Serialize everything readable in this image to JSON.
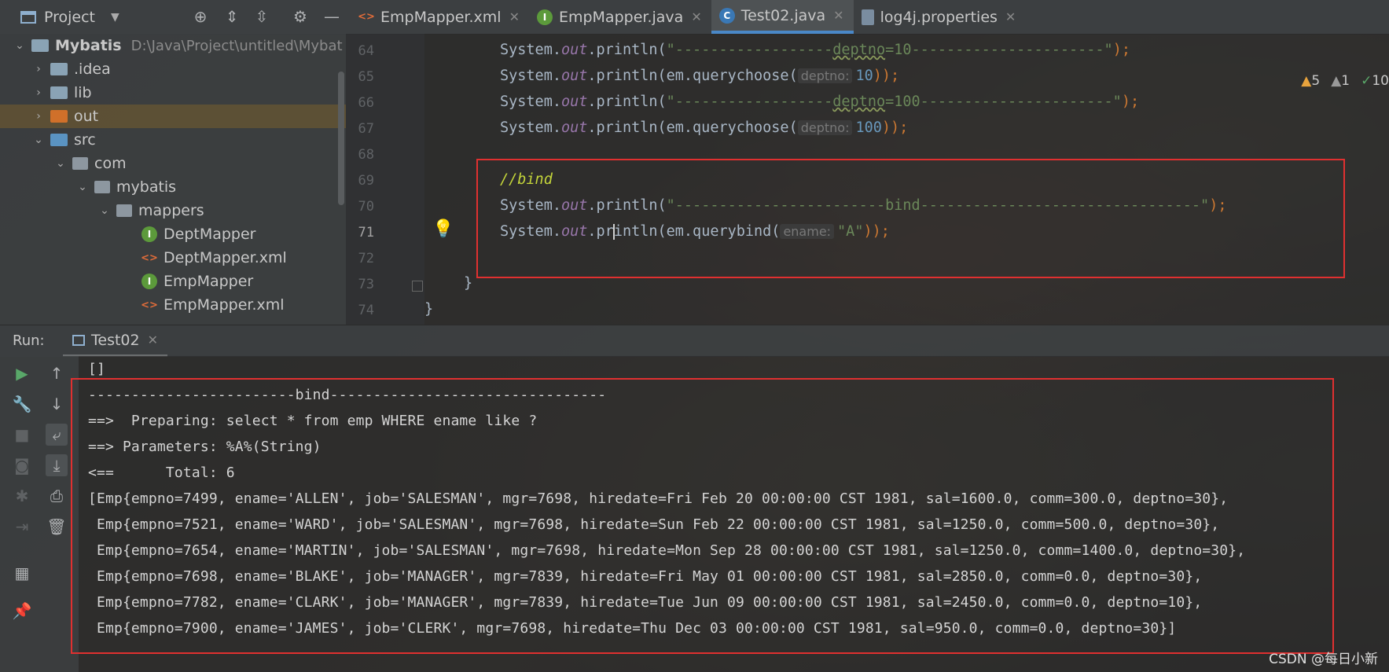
{
  "project_panel": {
    "title": "Project",
    "tree": [
      {
        "label": "Mybatis",
        "path": "D:\\Java\\Project\\untitled\\Mybat",
        "type": "module",
        "expanded": true
      },
      {
        "label": ".idea",
        "type": "folder",
        "expanded": false
      },
      {
        "label": "lib",
        "type": "folder",
        "expanded": false
      },
      {
        "label": "out",
        "type": "folder-excluded",
        "expanded": false,
        "selected": true
      },
      {
        "label": "src",
        "type": "folder-source",
        "expanded": true
      },
      {
        "label": "com",
        "type": "package",
        "expanded": true
      },
      {
        "label": "mybatis",
        "type": "package",
        "expanded": true
      },
      {
        "label": "mappers",
        "type": "package",
        "expanded": true
      },
      {
        "label": "DeptMapper",
        "type": "interface"
      },
      {
        "label": "DeptMapper.xml",
        "type": "xml"
      },
      {
        "label": "EmpMapper",
        "type": "interface"
      },
      {
        "label": "EmpMapper.xml",
        "type": "xml"
      }
    ]
  },
  "editor_tabs": [
    {
      "label": "EmpMapper.xml",
      "icon": "xml-file-icon",
      "active": false
    },
    {
      "label": "EmpMapper.java",
      "icon": "interface-file-icon",
      "active": false
    },
    {
      "label": "Test02.java",
      "icon": "class-file-icon",
      "active": true
    },
    {
      "label": "log4j.properties",
      "icon": "properties-file-icon",
      "active": false
    }
  ],
  "inspection": {
    "warnings": "5",
    "weak_warnings": "1",
    "ok": "10"
  },
  "editor": {
    "line_numbers": [
      "64",
      "65",
      "66",
      "67",
      "68",
      "69",
      "70",
      "71",
      "72",
      "73",
      "74"
    ],
    "l64_pre": "System.",
    "l64_out": "out",
    "l64_mid": ".println(",
    "l64_str_a": "\"------------------",
    "l64_str_b": "deptno",
    "l64_str_c": "=10----------------------\"",
    "l64_end": ");",
    "l65_pre": "System.",
    "l65_out": "out",
    "l65_mid": ".println(em.querychoose(",
    "l65_hint": "deptno:",
    "l65_num": "10",
    "l65_end": "));",
    "l66_pre": "System.",
    "l66_out": "out",
    "l66_mid": ".println(",
    "l66_str_a": "\"------------------",
    "l66_str_b": "deptno",
    "l66_str_c": "=100----------------------\"",
    "l66_end": ");",
    "l67_pre": "System.",
    "l67_out": "out",
    "l67_mid": ".println(em.querychoose(",
    "l67_hint": "deptno:",
    "l67_num": "100",
    "l67_end": "));",
    "l69_comment": "//bind",
    "l70_pre": "System.",
    "l70_out": "out",
    "l70_mid": ".println(",
    "l70_str": "\"------------------------bind--------------------------------\"",
    "l70_end": ");",
    "l71_pre": "System.",
    "l71_out": "out",
    "l71_mid_a": ".pr",
    "l71_mid_b": "intln(em.querybind(",
    "l71_hint": "ename:",
    "l71_str": "\"A\"",
    "l71_end": "));",
    "l73": "}",
    "l74": "}"
  },
  "run": {
    "label": "Run:",
    "tab": "Test02"
  },
  "console_lines": [
    "[]",
    "------------------------bind--------------------------------",
    "==>  Preparing: select * from emp WHERE ename like ?",
    "==> Parameters: %A%(String)",
    "<==      Total: 6",
    "[Emp{empno=7499, ename='ALLEN', job='SALESMAN', mgr=7698, hiredate=Fri Feb 20 00:00:00 CST 1981, sal=1600.0, comm=300.0, deptno=30},",
    " Emp{empno=7521, ename='WARD', job='SALESMAN', mgr=7698, hiredate=Sun Feb 22 00:00:00 CST 1981, sal=1250.0, comm=500.0, deptno=30},",
    " Emp{empno=7654, ename='MARTIN', job='SALESMAN', mgr=7698, hiredate=Mon Sep 28 00:00:00 CST 1981, sal=1250.0, comm=1400.0, deptno=30},",
    " Emp{empno=7698, ename='BLAKE', job='MANAGER', mgr=7839, hiredate=Fri May 01 00:00:00 CST 1981, sal=2850.0, comm=0.0, deptno=30},",
    " Emp{empno=7782, ename='CLARK', job='MANAGER', mgr=7839, hiredate=Tue Jun 09 00:00:00 CST 1981, sal=2450.0, comm=0.0, deptno=10},",
    " Emp{empno=7900, ename='JAMES', job='CLERK', mgr=7698, hiredate=Thu Dec 03 00:00:00 CST 1981, sal=950.0, comm=0.0, deptno=30}]"
  ],
  "watermark": "CSDN @每日小新",
  "colors": {
    "highlight_box": "#e03030",
    "accent": "#4a88c7"
  }
}
